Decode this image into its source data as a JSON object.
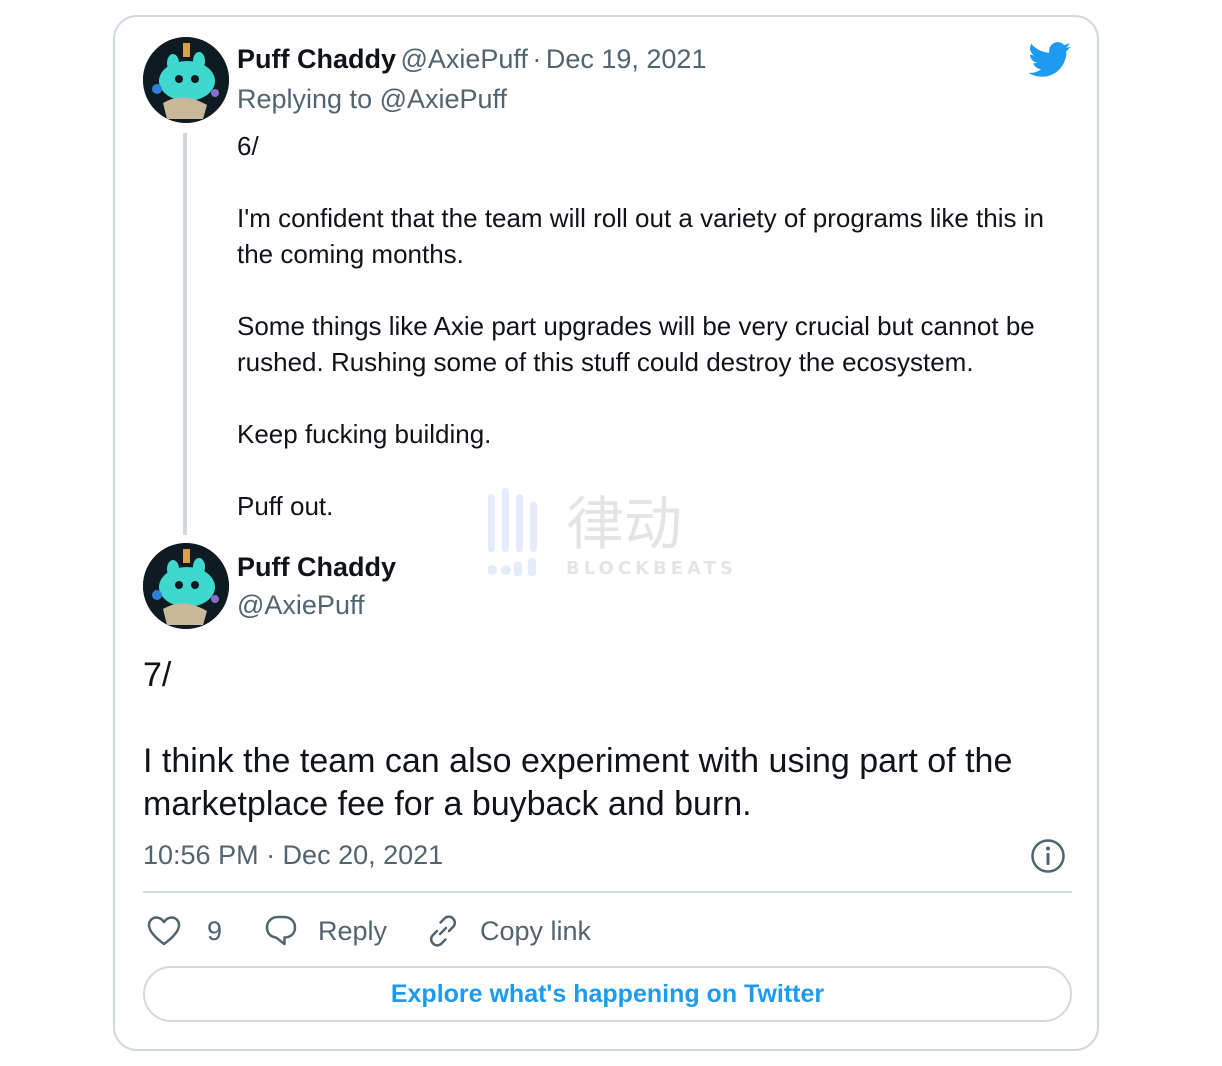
{
  "tweet_reply": {
    "author_name": "Puff Chaddy",
    "author_handle": "@AxiePuff",
    "separator": "·",
    "date": "Dec 19, 2021",
    "replying_to": "Replying to @AxiePuff",
    "paragraphs": [
      "6/",
      "I'm confident that the team will roll out a variety of programs like this in the coming months.",
      "Some things like Axie part upgrades will be very crucial but cannot be rushed. Rushing some of this stuff could destroy the ecosystem.",
      "Keep fucking building.",
      "Puff out."
    ]
  },
  "tweet_main": {
    "author_name": "Puff Chaddy",
    "author_handle": "@AxiePuff",
    "paragraphs": [
      "7/",
      "I think the team can also experiment with using part of the marketplace fee for a buyback and burn."
    ],
    "timestamp": "10:56 PM · Dec 20, 2021"
  },
  "actions": {
    "like_count": "9",
    "reply_label": "Reply",
    "copy_link_label": "Copy link"
  },
  "explore_label": "Explore what's happening on Twitter",
  "watermark": {
    "text_cn": "律动",
    "text_en": "BLOCKBEATS"
  },
  "colors": {
    "twitter_blue": "#1d9bf0",
    "muted": "#536471",
    "border": "#cfd9de"
  },
  "icons": {
    "logo": "twitter-bird-icon",
    "info": "info-icon",
    "like": "heart-icon",
    "reply": "speech-bubble-icon",
    "copy": "link-icon"
  }
}
